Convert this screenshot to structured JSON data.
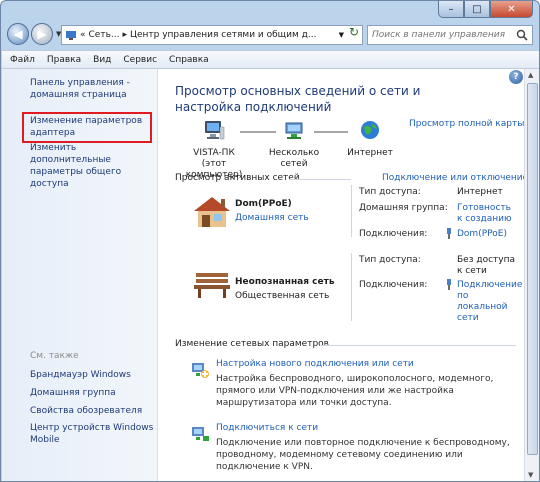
{
  "caption": {
    "min": "–",
    "max": "□",
    "close": "✕"
  },
  "address": {
    "overflow": "«",
    "crumb1": "Сеть...",
    "sep": "▸",
    "crumb2": "Центр управления сетями и общим д...",
    "refresh": "↻"
  },
  "search": {
    "placeholder": "Поиск в панели управления"
  },
  "menu": [
    "Файл",
    "Правка",
    "Вид",
    "Сервис",
    "Справка"
  ],
  "left": {
    "home": "Панель управления - домашняя страница",
    "adapter": "Изменение параметров адаптера",
    "sharing": "Изменить дополнительные параметры общего доступа",
    "see_also": "См. также",
    "firewall": "Брандмауэр Windows",
    "homegroup": "Домашняя группа",
    "browser": "Свойства обозревателя",
    "mobile": "Центр устройств Windows Mobile"
  },
  "main": {
    "title": "Просмотр основных сведений о сети и настройка подключений",
    "full_map": "Просмотр полной карты",
    "help": "?",
    "nodes": {
      "pc": "VISTA-ПК\n(этот компьютер)",
      "networks": "Несколько сетей",
      "internet": "Интернет"
    },
    "active_title": "Просмотр активных сетей",
    "connect_link": "Подключение или отключение",
    "net1": {
      "name": "Dom(PPoE)",
      "type": "Домашняя сеть",
      "access_key": "Тип доступа:",
      "access_val": "Интернет",
      "group_key": "Домашняя группа:",
      "group_val": "Готовность к созданию",
      "conn_key": "Подключения:",
      "conn_val": "Dom(PPoE)"
    },
    "net2": {
      "name": "Неопознанная сеть",
      "type": "Общественная сеть",
      "access_key": "Тип доступа:",
      "access_val": "Без доступа к сети",
      "conn_key": "Подключения:",
      "conn_val": "Подключение по локальной сети"
    },
    "change_title": "Изменение сетевых параметров",
    "task1": {
      "link": "Настройка нового подключения или сети",
      "desc": "Настройка беспроводного, широкополосного, модемного, прямого или VPN-подключения или же настройка маршрутизатора или точки доступа."
    },
    "task2": {
      "link": "Подключиться к сети",
      "desc": "Подключение или повторное подключение к беспроводному, проводному, модемному сетевому соединению или подключение к VPN."
    }
  }
}
